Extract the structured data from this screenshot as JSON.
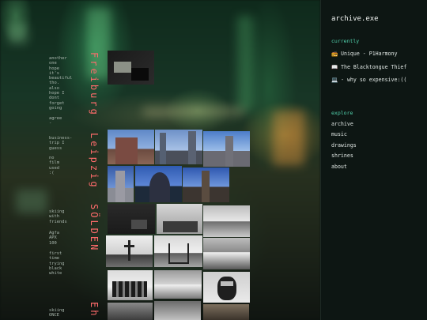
{
  "sidebar": {
    "title": "archive.exe",
    "currently_heading": "currently",
    "currently": [
      {
        "icon": "music-icon",
        "glyph": "📻",
        "text": "Unique - P1Harmony"
      },
      {
        "icon": "book-icon",
        "glyph": "📖",
        "text": "The Blacktongue Thief"
      },
      {
        "icon": "tv-icon",
        "glyph": "💻",
        "text": "- why so expensive:(("
      }
    ],
    "explore_heading": "explore",
    "explore": [
      "archive",
      "music",
      "drawings",
      "shrines",
      "about"
    ]
  },
  "timeline": {
    "headings": [
      "Freiburg",
      "Leipzig",
      "SÖLDEN",
      "Eh"
    ],
    "notes": [
      {
        "lines": [
          "another",
          "one",
          "hope",
          "it's",
          "beautiful",
          "tho.",
          "also",
          "hope I",
          "dont",
          "forget",
          "going",
          "",
          "agree",
          "  -"
        ]
      },
      {
        "lines": [
          "business-",
          "trip I",
          "guess",
          "",
          "no",
          "film",
          "used",
          ":("
        ]
      },
      {
        "lines": [
          "skiing",
          "with",
          "friends"
        ]
      },
      {
        "lines": [
          "Agfa",
          "APX",
          "100"
        ]
      },
      {
        "lines": [
          "first",
          "time",
          "trying",
          "black",
          "white"
        ]
      },
      {
        "lines": [
          "skiing",
          "ONCE"
        ]
      }
    ]
  },
  "colors": {
    "accent": "#52d3ae",
    "heading": "#ff6b6b",
    "sidebar_bg": "#0d1613"
  }
}
